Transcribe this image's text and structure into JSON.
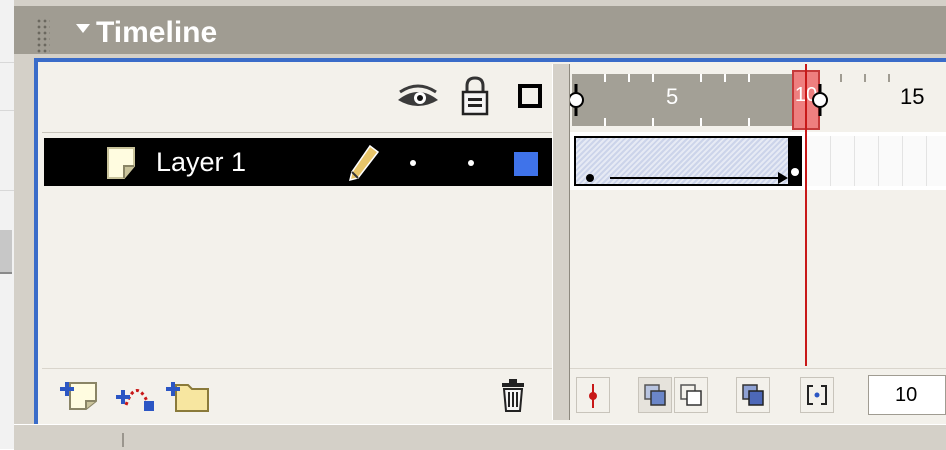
{
  "panel": {
    "title": "Timeline"
  },
  "header_icons": [
    "eye-icon",
    "lock-icon",
    "outline-icon"
  ],
  "layers": [
    {
      "name": "Layer 1",
      "visible": true,
      "locked": false,
      "outline_color": "#3f73ea",
      "active": true
    }
  ],
  "ruler": {
    "labels": [
      "5",
      "10",
      "15"
    ],
    "current_frame": "10"
  },
  "frame_controls": {
    "current_frame": "10"
  },
  "colors": {
    "selection": "#000000",
    "playhead": "#c81818",
    "layer_outline": "#3f73ea",
    "panel_border": "#3a6cc9"
  }
}
